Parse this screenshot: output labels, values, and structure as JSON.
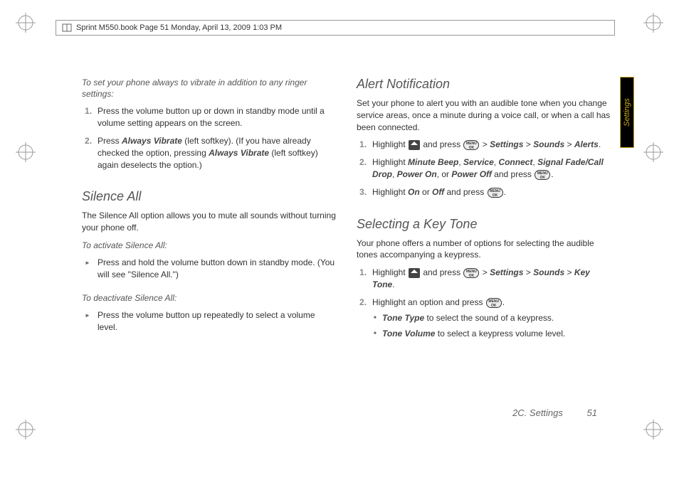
{
  "header": {
    "text": "Sprint M550.book  Page 51  Monday, April 13, 2009  1:03 PM"
  },
  "sideTab": {
    "label": "Settings"
  },
  "left": {
    "intro": "To set your phone always to vibrate in addition to any ringer settings:",
    "step1": "Press the volume button up or down in standby mode until a volume setting appears on the screen.",
    "step2_a": "Press ",
    "step2_b": "Always Vibrate",
    "step2_c": " (left softkey). (If you have already checked the option, pressing ",
    "step2_d": "Always Vibrate",
    "step2_e": " (left softkey) again deselects the option.)",
    "silenceHeading": "Silence All",
    "silenceBody": "The Silence All option allows you to mute all sounds without turning your phone off.",
    "activateLabel": "To activate Silence All:",
    "activateItem": "Press and hold the volume button down in standby mode. (You will see \"Silence All.\")",
    "deactivateLabel": "To deactivate Silence All:",
    "deactivateItem": "Press the volume button up repeatedly to select a volume level."
  },
  "right": {
    "alertHeading": "Alert Notification",
    "alertBody": "Set your phone to alert you with an audible tone when you change service areas, once a minute during a voice call, or when a call has been connected.",
    "a1_a": "Highlight ",
    "a1_b": " and press ",
    "a1_c": " > ",
    "a1_path1": "Settings",
    "a1_path2": "Sounds",
    "a1_path3": "Alerts",
    "a1_end": ".",
    "a2_a": "Highlight ",
    "a2_opt1": "Minute Beep",
    "a2_sep": ", ",
    "a2_opt2": "Service",
    "a2_opt3": "Connect",
    "a2_opt4": "Signal Fade/Call Drop",
    "a2_opt5": "Power On",
    "a2_or": ", or ",
    "a2_opt6": "Power Off",
    "a2_b": " and press ",
    "a2_end": ".",
    "a3_a": "Highlight ",
    "a3_on": "On",
    "a3_or": " or ",
    "a3_off": "Off",
    "a3_b": " and press ",
    "a3_end": ".",
    "keyHeading": "Selecting a Key Tone",
    "keyBody": "Your phone offers a number of options for selecting the audible tones accompanying a keypress.",
    "k1_a": "Highlight ",
    "k1_b": " and press ",
    "k1_c": " > ",
    "k1_path1": "Settings",
    "k1_path2": "Sounds",
    "k1_path3": "Key Tone",
    "k1_end": ".",
    "k2_a": "Highlight an option and press ",
    "k2_end": ".",
    "k_sub1a": "Tone Type",
    "k_sub1b": " to select the sound of a keypress.",
    "k_sub2a": "Tone Volume",
    "k_sub2b": " to select a keypress volume level."
  },
  "footer": {
    "section": "2C. Settings",
    "page": "51"
  },
  "menuLabel": "MENU OK"
}
